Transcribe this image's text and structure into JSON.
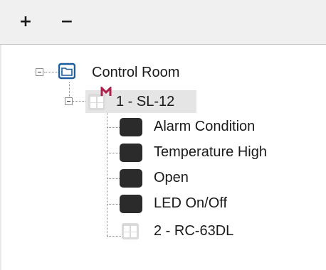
{
  "toolbar": {
    "add_label": "+",
    "remove_label": "−"
  },
  "tree": {
    "root": {
      "label": "Control Room",
      "icon": "folder-icon",
      "expanded": true
    },
    "device": {
      "label": "1 - SL-12",
      "icon": "device-grid-icon",
      "badge": "M",
      "badge_color": "#b0204a",
      "expanded": true,
      "selected": true
    },
    "children": [
      {
        "label": "Alarm Condition",
        "icon": "input-icon"
      },
      {
        "label": "Temperature High",
        "icon": "input-icon"
      },
      {
        "label": "Open",
        "icon": "input-icon"
      },
      {
        "label": "LED On/Off",
        "icon": "input-icon"
      }
    ],
    "sibling": {
      "label": "2 - RC-63DL",
      "icon": "device-grid-icon"
    }
  },
  "colors": {
    "toolbar_bg": "#f0f0f0",
    "folder_blue": "#1c5c9b",
    "selection_bg": "#e5e5e5",
    "input_icon": "#2b2b2b",
    "grid_icon": "#dadada"
  }
}
